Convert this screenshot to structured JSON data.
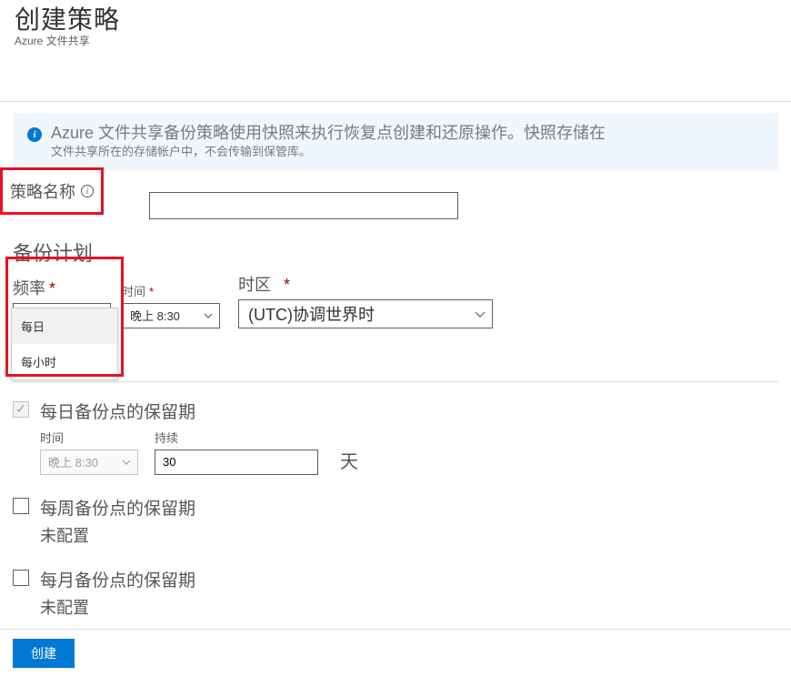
{
  "header": {
    "title": "创建策略",
    "subtitle": "Azure 文件共享"
  },
  "info": {
    "line1": "Azure 文件共享备份策略使用快照来执行恢复点创建和还原操作。快照存储在",
    "line2": "文件共享所在的存储帐户中，不会传输到保管库。"
  },
  "policy_name": {
    "label": "策略名称",
    "value": ""
  },
  "schedule": {
    "section_title": "备份计划",
    "frequency": {
      "label": "频率",
      "value": "每日",
      "options": [
        "每日",
        "每小时"
      ]
    },
    "time": {
      "label": "时间",
      "value": "晚上 8:30"
    },
    "timezone": {
      "label": "时区",
      "value": "(UTC)协调世界时"
    }
  },
  "retention": {
    "daily": {
      "title": "每日备份点的保留期",
      "time_label": "时间",
      "time_value": "晚上 8:30",
      "duration_label": "持续",
      "duration_value": "30",
      "unit": "天"
    },
    "weekly": {
      "title": "每周备份点的保留期",
      "status": "未配置"
    },
    "monthly": {
      "title": "每月备份点的保留期",
      "status": "未配置"
    }
  },
  "footer": {
    "create": "创建"
  }
}
